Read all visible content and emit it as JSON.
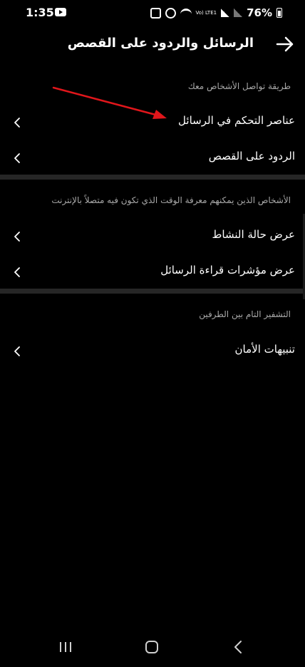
{
  "status_bar": {
    "time": "1:35",
    "battery_percent": "76%",
    "volte_label": "Vo) LTE1",
    "icons": [
      "youtube-icon",
      "alarm-icon",
      "clock-icon",
      "wifi-icon",
      "volte-icon",
      "signal-icon",
      "signal-secondary-icon",
      "battery-icon"
    ]
  },
  "header": {
    "title": "الرسائل والردود على القصص",
    "back_icon": "arrow-right-icon"
  },
  "sections": [
    {
      "caption": "طريقة تواصل الأشخاص معك",
      "items": [
        {
          "label": "عناصر التحكم في الرسائل",
          "icon": "chevron-left-icon"
        },
        {
          "label": "الردود على القصص",
          "icon": "chevron-left-icon"
        }
      ]
    },
    {
      "caption": "الأشخاص الذين يمكنهم معرفة الوقت الذي تكون فيه متصلاً بالإنترنت",
      "items": [
        {
          "label": "عرض حالة النشاط",
          "icon": "chevron-left-icon"
        },
        {
          "label": "عرض مؤشرات قراءة الرسائل",
          "icon": "chevron-left-icon"
        }
      ]
    },
    {
      "caption": "التشفير التام بين الطرفين",
      "items": [
        {
          "label": "تنبيهات الأمان",
          "icon": "chevron-left-icon"
        }
      ]
    }
  ],
  "annotation": {
    "color": "#e0161b",
    "target": "عناصر التحكم في الرسائل"
  },
  "nav_bar": {
    "icons": [
      "recents-icon",
      "home-icon",
      "back-icon"
    ]
  },
  "colors": {
    "background": "#000000",
    "text": "#ffffff",
    "caption": "#a8a8a8",
    "divider": "#262626"
  }
}
